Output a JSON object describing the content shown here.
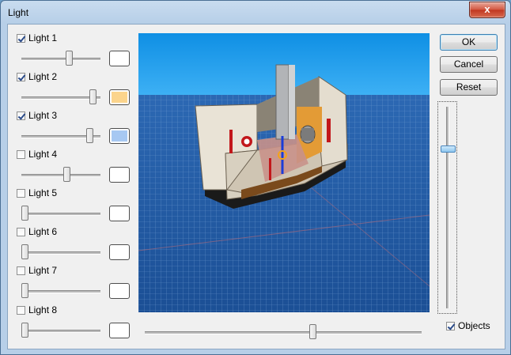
{
  "window": {
    "title": "Light",
    "close_glyph": "x"
  },
  "lights": [
    {
      "label": "Light 1",
      "checked": true,
      "level": 0.62,
      "color": "#ffffff"
    },
    {
      "label": "Light 2",
      "checked": true,
      "level": 0.95,
      "color": "#fbd48c"
    },
    {
      "label": "Light 3",
      "checked": true,
      "level": 0.9,
      "color": "#a7c8f2"
    },
    {
      "label": "Light 4",
      "checked": false,
      "level": 0.58,
      "color": "#ffffff"
    },
    {
      "label": "Light 5",
      "checked": false,
      "level": 0.0,
      "color": "#ffffff"
    },
    {
      "label": "Light 6",
      "checked": false,
      "level": 0.0,
      "color": "#ffffff"
    },
    {
      "label": "Light 7",
      "checked": false,
      "level": 0.0,
      "color": "#ffffff"
    },
    {
      "label": "Light 8",
      "checked": false,
      "level": 0.0,
      "color": "#ffffff"
    }
  ],
  "buttons": {
    "ok": "OK",
    "cancel": "Cancel",
    "reset": "Reset"
  },
  "bottom_slider_level": 0.61,
  "vertical_slider_level": 0.8,
  "objects": {
    "label": "Objects",
    "checked": true
  },
  "icons": {
    "close": "close-icon"
  }
}
